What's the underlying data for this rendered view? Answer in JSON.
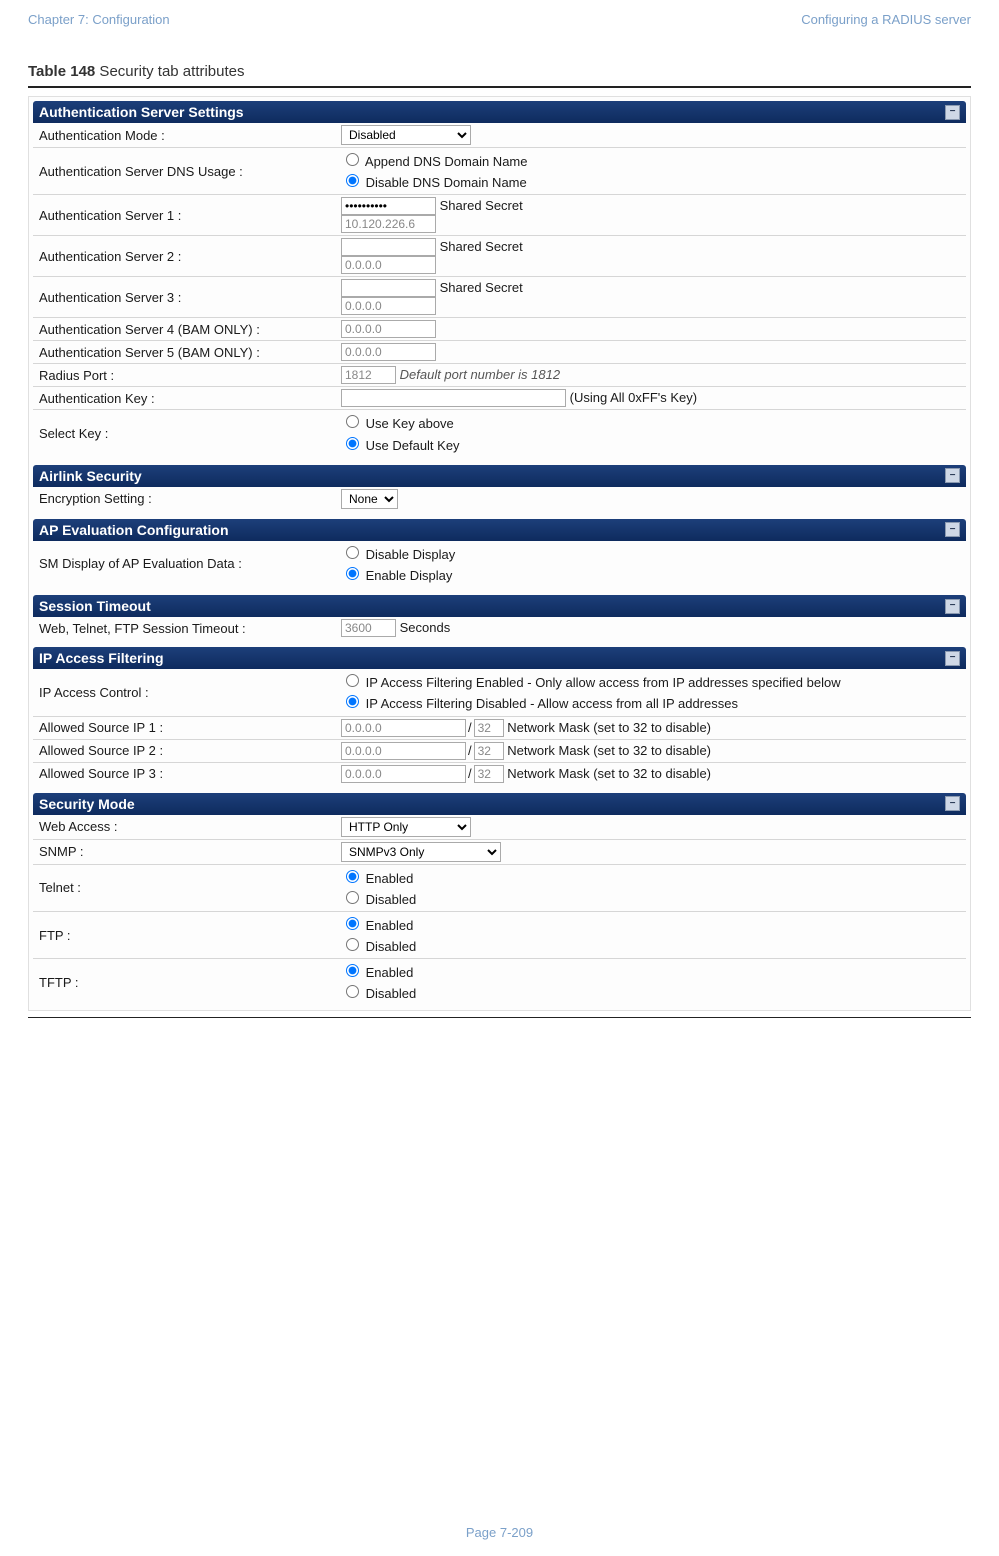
{
  "header": {
    "left": "Chapter 7:  Configuration",
    "right": "Configuring a RADIUS server"
  },
  "titleBold": "Table 148",
  "titleRest": " Security tab attributes",
  "sections": {
    "auth": {
      "title": "Authentication Server Settings",
      "mode_lbl": "Authentication Mode :",
      "mode_val": "Disabled",
      "dns_lbl": "Authentication Server DNS Usage :",
      "dns_opt1": "Append DNS Domain Name",
      "dns_opt2": "Disable DNS Domain Name",
      "s1_lbl": "Authentication Server 1 :",
      "s1_val": "----------",
      "s1_ip": "10.120.226.6",
      "shared": "Shared Secret",
      "s2_lbl": "Authentication Server 2 :",
      "zeroip": "0.0.0.0",
      "s3_lbl": "Authentication Server 3 :",
      "s4_lbl": "Authentication Server 4 (BAM ONLY) :",
      "s5_lbl": "Authentication Server 5 (BAM ONLY) :",
      "port_lbl": "Radius Port :",
      "port_val": "1812",
      "port_note": "Default port number is 1812",
      "key_lbl": "Authentication Key :",
      "key_note": "(Using All 0xFF's Key)",
      "sel_lbl": "Select Key :",
      "sel_opt1": "Use Key above",
      "sel_opt2": "Use Default Key"
    },
    "airlink": {
      "title": "Airlink Security",
      "enc_lbl": "Encryption Setting :",
      "enc_val": "None"
    },
    "apeval": {
      "title": "AP Evaluation Configuration",
      "sm_lbl": "SM Display of AP Evaluation Data :",
      "opt1": "Disable Display",
      "opt2": "Enable Display"
    },
    "session": {
      "title": "Session Timeout",
      "lbl": "Web, Telnet, FTP Session Timeout :",
      "val": "3600",
      "unit": "Seconds"
    },
    "ipfilter": {
      "title": "IP Access Filtering",
      "ctrl_lbl": "IP Access Control :",
      "opt1": "IP Access Filtering Enabled - Only allow access from IP addresses specified below",
      "opt2": "IP Access Filtering Disabled - Allow access from all IP addresses",
      "src1_lbl": "Allowed Source IP 1 :",
      "src2_lbl": "Allowed Source IP 2 :",
      "src3_lbl": "Allowed Source IP 3 :",
      "mask": "32",
      "note": "Network Mask (set to 32 to disable)"
    },
    "secmode": {
      "title": "Security Mode",
      "web_lbl": "Web Access :",
      "web_val": "HTTP Only",
      "snmp_lbl": "SNMP :",
      "snmp_val": "SNMPv3 Only",
      "telnet_lbl": "Telnet :",
      "ftp_lbl": "FTP :",
      "tftp_lbl": "TFTP :",
      "enabled": "Enabled",
      "disabled": "Disabled"
    }
  },
  "footer": "Page 7-209"
}
